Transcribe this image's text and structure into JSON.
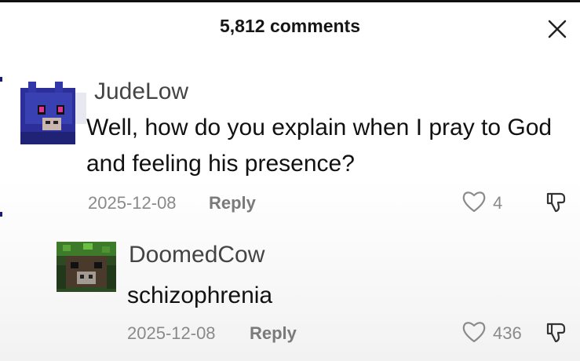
{
  "header": {
    "title": "5,812 comments",
    "close_icon": "close-icon"
  },
  "comments": [
    {
      "username": "JudeLow",
      "text": "Well, how do you explain when I pray to God and feeling his presence?",
      "date": "2025-12-08",
      "reply_label": "Reply",
      "likes": "4",
      "avatar": "blue-minecraft-bonnie-avatar"
    },
    {
      "username": "DoomedCow",
      "text": "schizophrenia",
      "date": "2025-12-08",
      "reply_label": "Reply",
      "likes": "436",
      "avatar": "green-minecraft-cow-avatar"
    }
  ],
  "colors": {
    "text": "#111111",
    "muted": "#8a8a8a",
    "username": "#444444"
  }
}
